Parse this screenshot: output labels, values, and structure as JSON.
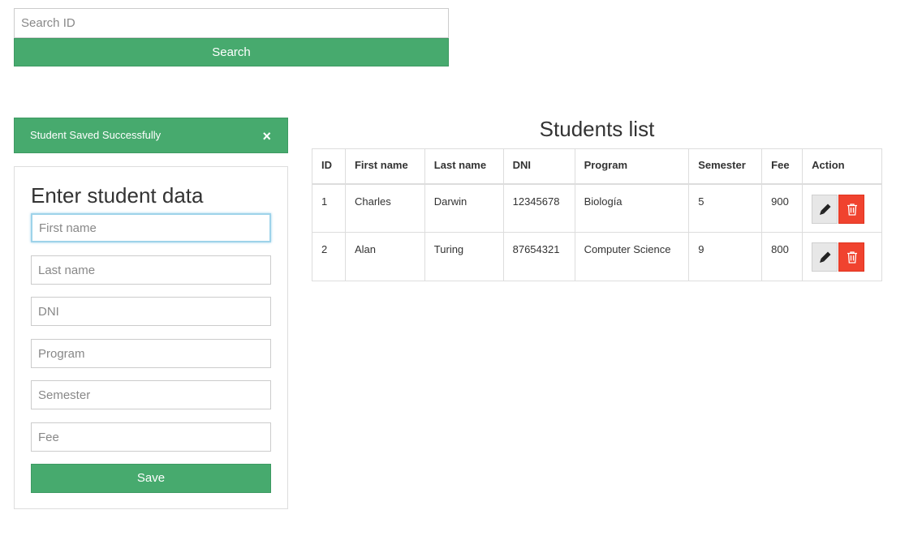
{
  "search": {
    "placeholder": "Search ID",
    "button_label": "Search"
  },
  "alert": {
    "message": "Student Saved Successfully",
    "close_glyph": "×"
  },
  "form": {
    "title": "Enter student data",
    "fields": {
      "first_name": "First name",
      "last_name": "Last name",
      "dni": "DNI",
      "program": "Program",
      "semester": "Semester",
      "fee": "Fee"
    },
    "save_label": "Save"
  },
  "students": {
    "title": "Students list",
    "columns": [
      "ID",
      "First name",
      "Last name",
      "DNI",
      "Program",
      "Semester",
      "Fee",
      "Action"
    ],
    "rows": [
      {
        "id": "1",
        "first_name": "Charles",
        "last_name": "Darwin",
        "dni": "12345678",
        "program": "Biología",
        "semester": "5",
        "fee": "900"
      },
      {
        "id": "2",
        "first_name": "Alan",
        "last_name": "Turing",
        "dni": "87654321",
        "program": "Computer Science",
        "semester": "9",
        "fee": "800"
      }
    ],
    "icons": {
      "edit": "pencil-icon",
      "delete": "trash-icon"
    }
  },
  "colors": {
    "primary_green": "#47aa6e",
    "danger_red": "#f0432f",
    "focus_blue": "#9ed3ea"
  }
}
